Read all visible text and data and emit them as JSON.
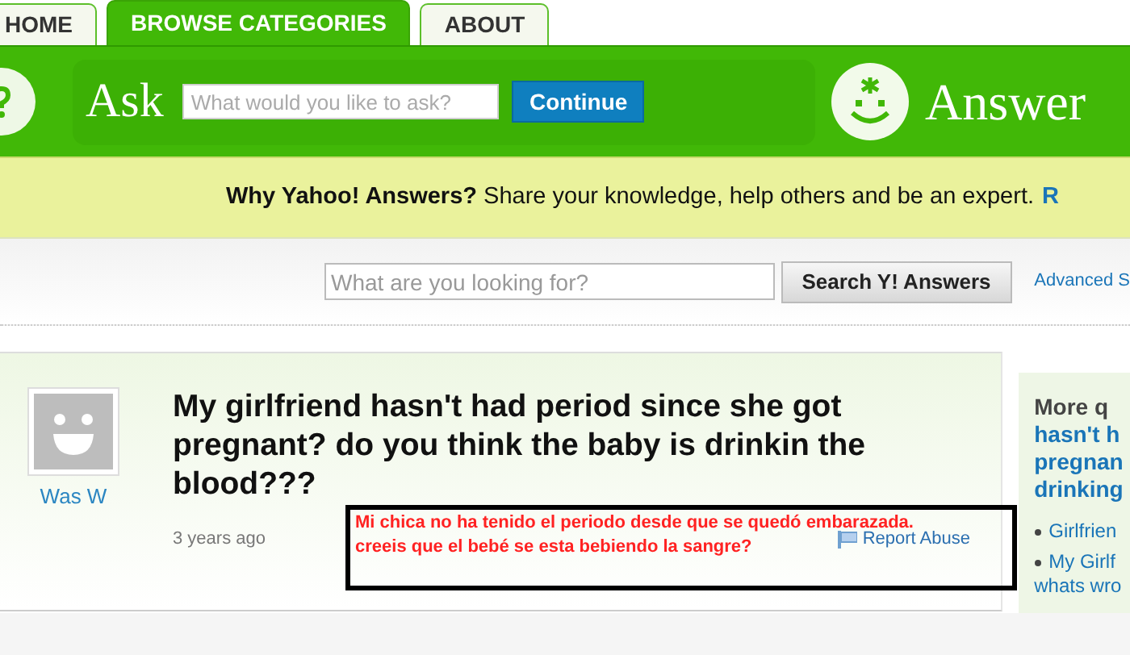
{
  "tabs": [
    {
      "label": "HOME",
      "selected": false
    },
    {
      "label": "BROWSE CATEGORIES",
      "selected": true
    },
    {
      "label": "ABOUT",
      "selected": false
    }
  ],
  "ask": {
    "title": "Ask",
    "placeholder": "What would you like to ask?",
    "button": "Continue"
  },
  "answer": {
    "title": "Answer"
  },
  "promo": {
    "text": "**Why Yahoo! Answers?** Share your knowledge, help others and be an expert.",
    "link": "R"
  },
  "search": {
    "placeholder": "What are you looking for?",
    "button": "Search Y! Answers",
    "advanced_link": "Advanced S"
  },
  "question": {
    "author": "Was W",
    "title": "My girlfriend hasn't had period since she got pregnant? do you think the baby is drinkin the blood???",
    "time": "3 years ago",
    "report": "Report Abuse"
  },
  "overlay": {
    "lines": [
      "Mi chica no ha tenido el periodo desde que se quedó embarazada.",
      "creeis que el bebé se esta bebiendo la sangre?"
    ]
  },
  "sidebar": {
    "heading": "More q",
    "title_lines": [
      "hasn't h",
      "pregnan",
      "drinking"
    ],
    "items": [
      {
        "lines": [
          "Girlfrien"
        ]
      },
      {
        "lines": [
          "My Girlf",
          "whats wro"
        ]
      }
    ]
  }
}
